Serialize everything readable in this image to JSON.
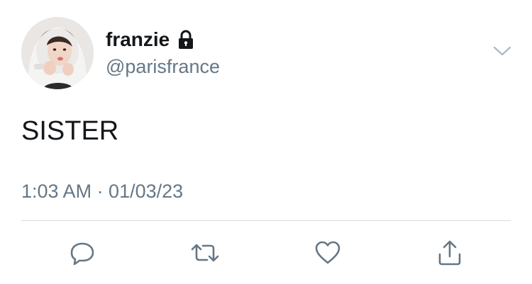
{
  "tweet": {
    "user": {
      "display_name": "franzie",
      "handle": "@parisfrance",
      "protected_icon": "lock-icon",
      "avatar": "avatar"
    },
    "text": "SISTER",
    "timestamp": "1:03 AM · 01/03/23",
    "menu_icon": "chevron-down-icon"
  },
  "actions": [
    {
      "icon": "reply-icon"
    },
    {
      "icon": "retweet-icon"
    },
    {
      "icon": "heart-icon"
    },
    {
      "icon": "share-icon"
    }
  ],
  "colors": {
    "primary_text": "#14171a",
    "secondary_text": "#657786",
    "divider": "#d5dade",
    "icon": "#657786"
  }
}
